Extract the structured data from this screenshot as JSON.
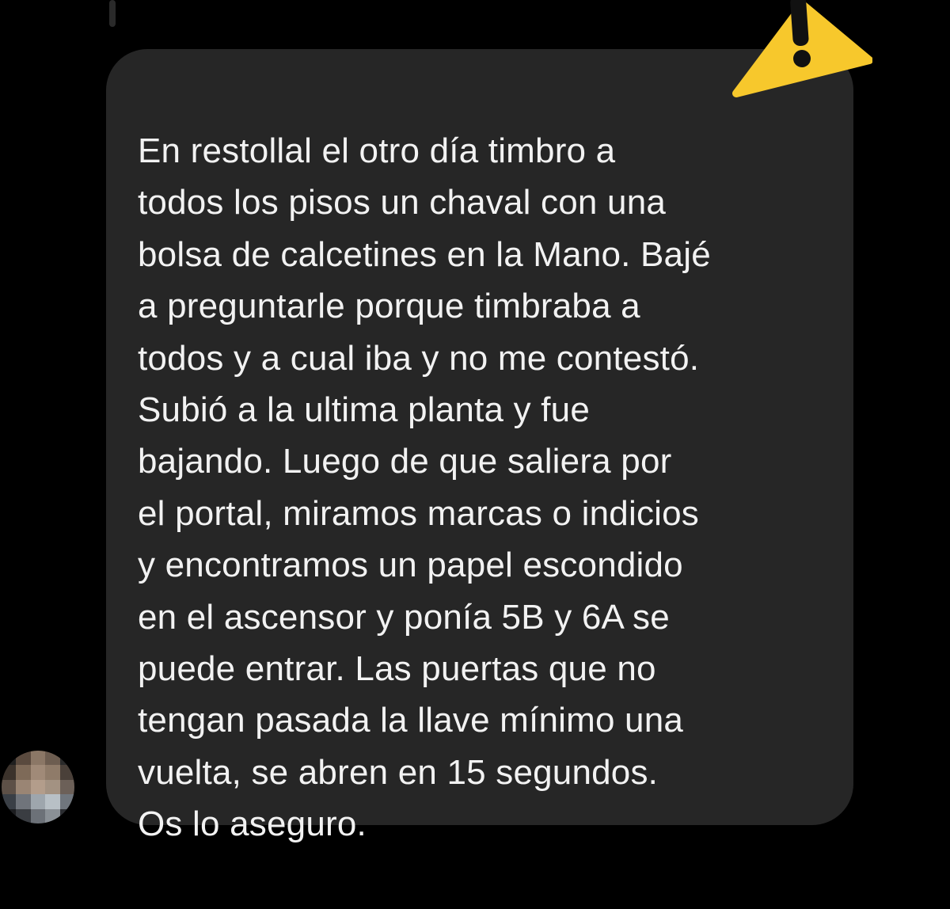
{
  "message": {
    "lines": [
      "En restollal el otro día timbro a",
      "todos los pisos un chaval con una",
      "bolsa de calcetines en la Mano. Bajé",
      "a preguntarle porque timbraba a",
      "todos y a cual iba y no me contestó.",
      "Subió a la ultima planta y fue",
      "bajando. Luego de que saliera por",
      "el portal, miramos marcas o indicios",
      "y encontramos un papel escondido",
      "en el ascensor y ponía 5B y  6A se",
      "puede entrar. Las puertas que no",
      "tengan pasada la llave mínimo una",
      "vuelta, se abren en 15 segundos.",
      "Os lo aseguro."
    ]
  },
  "icons": {
    "warning": "warning-icon",
    "avatar": "avatar"
  },
  "colors": {
    "background": "#000000",
    "bubble": "#262626",
    "text": "#f2f2f2",
    "warning": "#f7c82c"
  }
}
